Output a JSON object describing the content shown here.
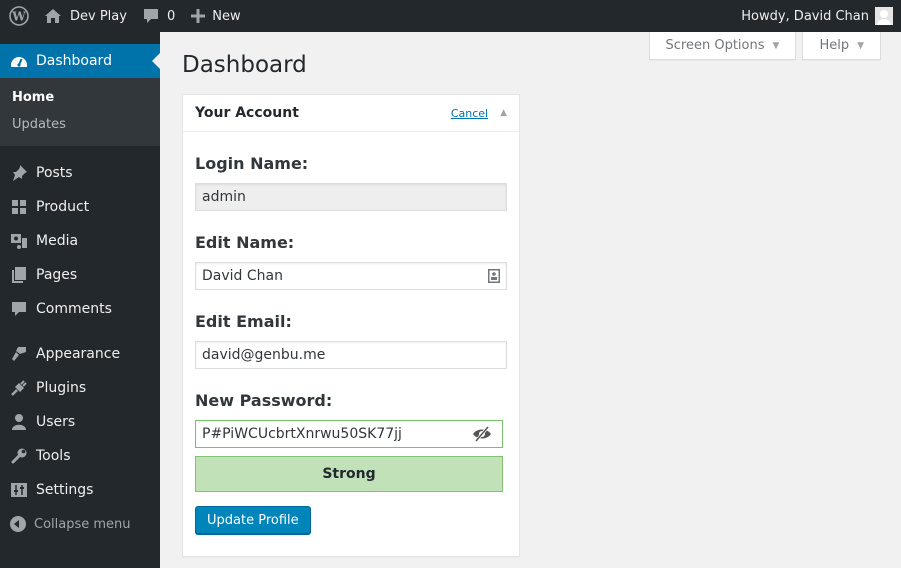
{
  "admin_bar": {
    "site_name": "Dev Play",
    "comments_count": "0",
    "new_label": "New",
    "greeting": "Howdy, David Chan"
  },
  "sidebar": {
    "dashboard_label": "Dashboard",
    "submenu": [
      {
        "label": "Home",
        "active": true
      },
      {
        "label": "Updates",
        "active": false
      }
    ],
    "items": [
      {
        "label": "Posts",
        "icon": "pin-icon"
      },
      {
        "label": "Product",
        "icon": "grid-icon"
      },
      {
        "label": "Media",
        "icon": "media-icon"
      },
      {
        "label": "Pages",
        "icon": "pages-icon"
      },
      {
        "label": "Comments",
        "icon": "comment-icon"
      },
      {
        "label": "Appearance",
        "icon": "brush-icon"
      },
      {
        "label": "Plugins",
        "icon": "plug-icon"
      },
      {
        "label": "Users",
        "icon": "user-icon"
      },
      {
        "label": "Tools",
        "icon": "wrench-icon"
      },
      {
        "label": "Settings",
        "icon": "settings-icon"
      }
    ],
    "collapse_label": "Collapse menu"
  },
  "screen_meta": {
    "screen_options": "Screen Options",
    "help": "Help"
  },
  "page_title": "Dashboard",
  "account_box": {
    "title": "Your Account",
    "cancel": "Cancel",
    "login_label": "Login Name:",
    "login_value": "admin",
    "name_label": "Edit Name:",
    "name_value": "David Chan",
    "email_label": "Edit Email:",
    "email_value": "david@genbu.me",
    "password_label": "New Password:",
    "password_value": "P#PiWCUcbrtXnrwu50SK77jj",
    "strength": "Strong",
    "submit": "Update Profile"
  },
  "colors": {
    "admin_bar": "#23282d",
    "accent": "#0073aa",
    "button": "#0085ba",
    "strength_bg": "#c1e1b9"
  }
}
